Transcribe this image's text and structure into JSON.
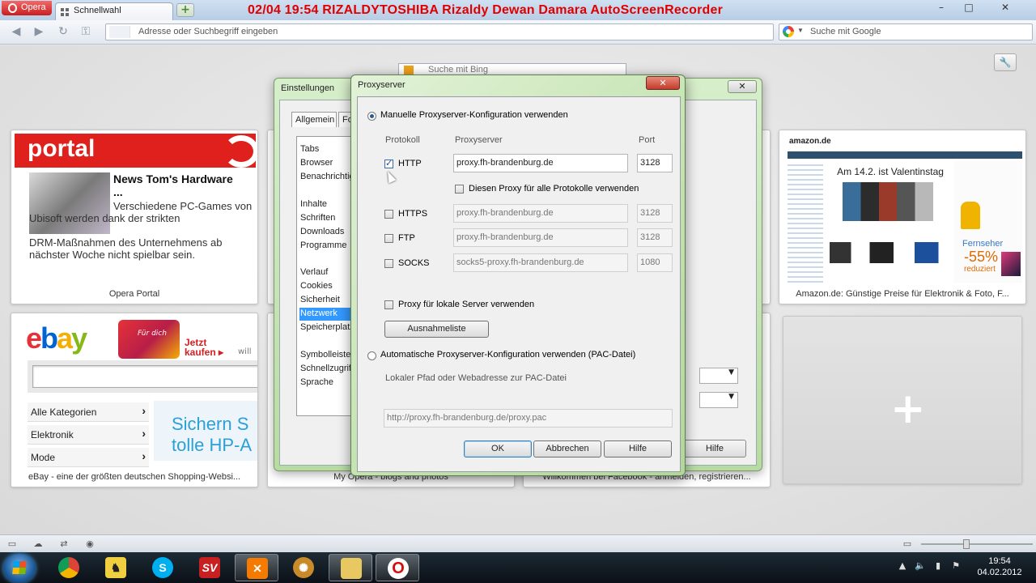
{
  "browser": {
    "menu_label": "Opera",
    "tab_title": "Schnellwahl",
    "new_tab_symbol": "+",
    "recorder_overlay": "02/04  19:54  RIZALDYTOSHIBA  Rizaldy Dewan Damara  AutoScreenRecorder",
    "address_placeholder": "Adresse oder Suchbegriff eingeben",
    "search_placeholder": "Suche mit Google",
    "window_controls": [
      "–",
      "□",
      "✕"
    ]
  },
  "speed_dial": {
    "portal": {
      "logo": "portal",
      "headline": "News Tom's Hardware ...",
      "teaser_1": "Verschiedene PC-Games von Ubisoft werden dank der strikten",
      "teaser_2": "DRM-Maßnahmen des Unternehmens ab nächster Woche nicht spielbar sein.",
      "caption": "Opera Portal"
    },
    "ebay": {
      "logo": [
        "e",
        "b",
        "a",
        "y"
      ],
      "promo": "Für dich",
      "cta": "Jetzt kaufen ▸",
      "cta_suffix": "will",
      "categories": [
        "Alle Kategorien",
        "Elektronik",
        "Mode"
      ],
      "ad_line_1": "Sichern S",
      "ad_line_2": "tolle HP-A",
      "caption": "eBay - eine der größten deutschen Shopping-Websi..."
    },
    "myopera": {
      "caption": "My Opera - blogs and photos"
    },
    "facebook": {
      "caption": "Willkommen bei Facebook - anmelden, registrieren..."
    },
    "amazon": {
      "logo": "amazon.de",
      "banner": "Am 14.2. ist Valentinstag",
      "promo": "Fernseher",
      "percent": "-55%",
      "reduced": "reduziert",
      "caption": "Amazon.de: Günstige Preise für Elektronik & Foto, F..."
    },
    "add_symbol": "+"
  },
  "settings_dialog": {
    "title": "Einstellungen",
    "close": "✕",
    "tabs": [
      "Allgemein",
      "Fo"
    ],
    "items": [
      "Tabs",
      "Browser",
      "Benachrichtig",
      "Inhalte",
      "Schriften",
      "Downloads",
      "Programme",
      "Verlauf",
      "Cookies",
      "Sicherheit",
      "Netzwerk",
      "Speicherplatz",
      "Symbolleiste",
      "Schnellzugriff",
      "Sprache"
    ],
    "selected_item": "Netzwerk",
    "help": "Hilfe",
    "bing_placeholder": "Suche mit Bing"
  },
  "proxy_dialog": {
    "title": "Proxyserver",
    "close": "✕",
    "manual_option": "Manuelle Proxyserver-Konfiguration verwenden",
    "col_protocol": "Protokoll",
    "col_server": "Proxyserver",
    "col_port": "Port",
    "rows": [
      {
        "protocol": "HTTP",
        "checked": true,
        "server": "proxy.fh-brandenburg.de",
        "port": "3128"
      },
      {
        "protocol": "HTTPS",
        "checked": false,
        "server": "proxy.fh-brandenburg.de",
        "port": "3128"
      },
      {
        "protocol": "FTP",
        "checked": false,
        "server": "proxy.fh-brandenburg.de",
        "port": "3128"
      },
      {
        "protocol": "SOCKS",
        "checked": false,
        "server": "socks5-proxy.fh-brandenburg.de",
        "port": "1080"
      }
    ],
    "same_proxy_label": "Diesen Proxy für alle Protokolle verwenden",
    "local_proxy_label": "Proxy für lokale Server verwenden",
    "exceptions_button": "Ausnahmeliste",
    "auto_option": "Automatische Proxyserver-Konfiguration verwenden (PAC-Datei)",
    "pac_label": "Lokaler Pfad oder Webadresse zur PAC-Datei",
    "pac_value": "http://proxy.fh-brandenburg.de/proxy.pac",
    "ok": "OK",
    "cancel": "Abbrechen",
    "help": "Hilfe"
  },
  "taskbar": {
    "time": "19:54",
    "date": "04.02.2012",
    "apps": [
      "chrome-icon",
      "bird-icon",
      "skype-icon",
      "sv-icon",
      "xampp-icon",
      "film-reel-icon",
      "folder-icon",
      "opera-icon"
    ]
  }
}
